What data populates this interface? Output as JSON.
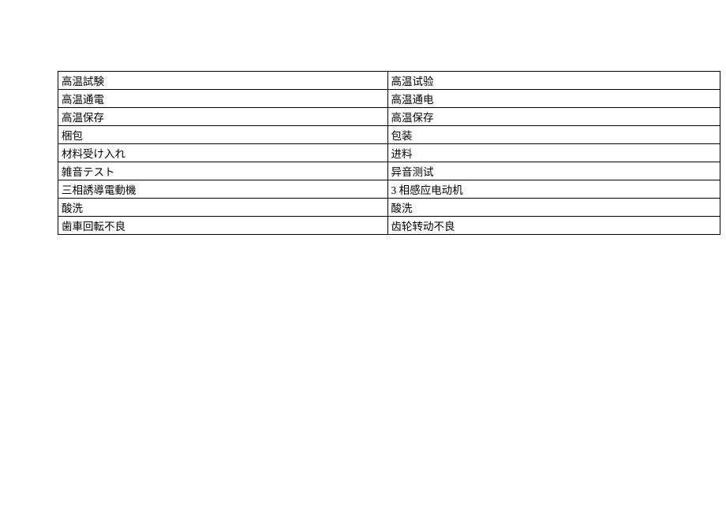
{
  "rows": [
    {
      "jp": "高温試験",
      "cn": "高温试验"
    },
    {
      "jp": "高温通電",
      "cn": "高温通电"
    },
    {
      "jp": "高温保存",
      "cn": "高温保存"
    },
    {
      "jp": "梱包",
      "cn": "包装"
    },
    {
      "jp": "材料受け入れ",
      "cn": "进料"
    },
    {
      "jp": "雑音テスト",
      "cn": "异音测试"
    },
    {
      "jp": "三相誘導電動機",
      "cn": "3 相感应电动机"
    },
    {
      "jp": "酸洗",
      "cn": "酸洗"
    },
    {
      "jp": "歯車回転不良",
      "cn": "齿轮转动不良"
    }
  ]
}
